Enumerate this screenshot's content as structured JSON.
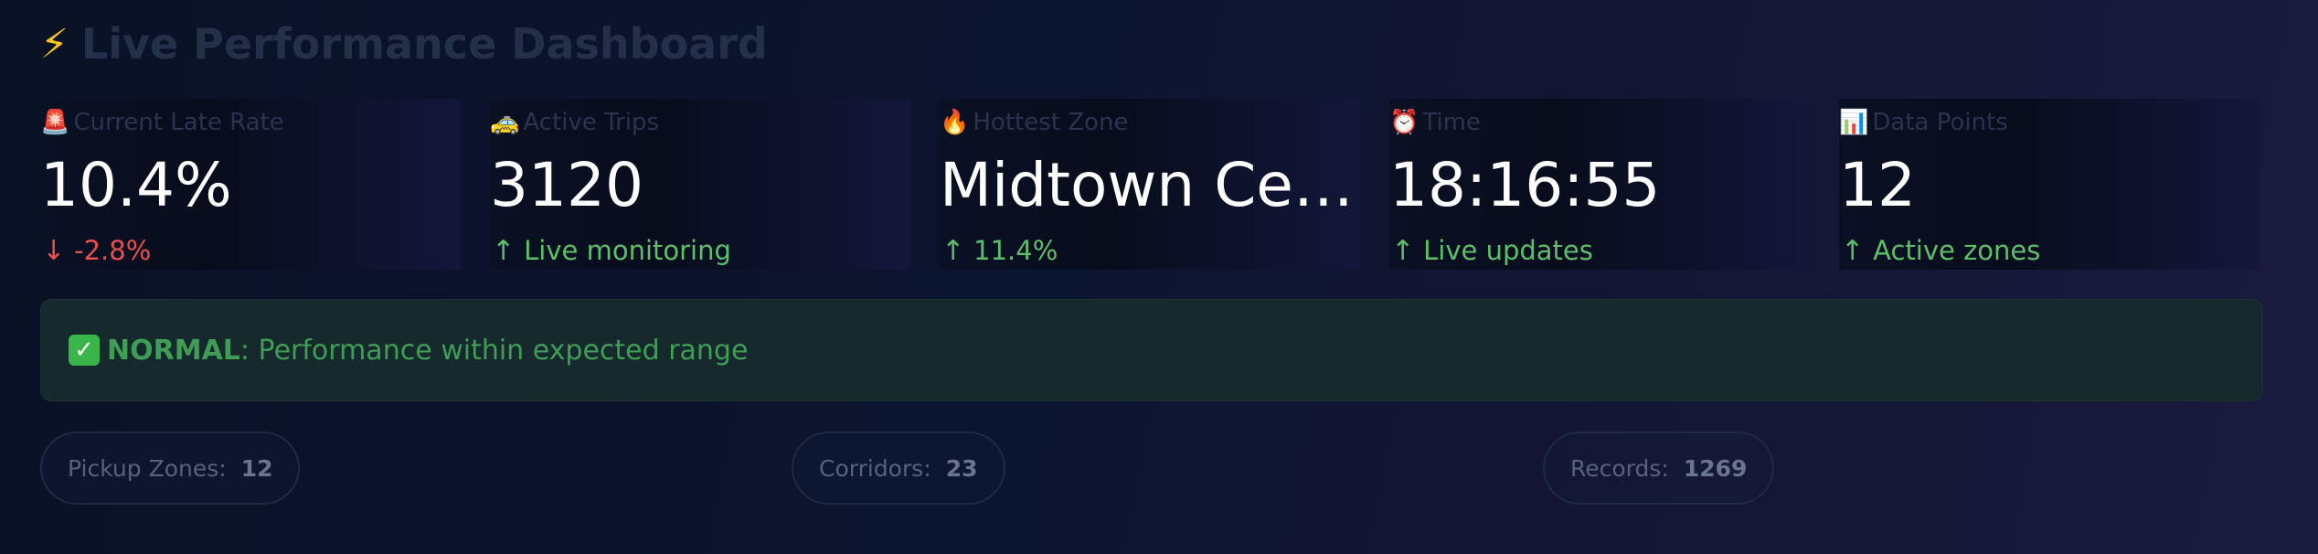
{
  "header": {
    "icon": "lightning-bolt-icon",
    "title": "Live Performance Dashboard"
  },
  "metrics": [
    {
      "icon": "siren-icon",
      "label": "Current Late Rate",
      "value": "10.4%",
      "delta": "-2.8%",
      "delta_direction": "down"
    },
    {
      "icon": "taxi-icon",
      "label": "Active Trips",
      "value": "3120",
      "delta": "Live monitoring",
      "delta_direction": "up"
    },
    {
      "icon": "fire-icon",
      "label": "Hottest Zone",
      "value": "Midtown Ce…",
      "delta": "11.4%",
      "delta_direction": "up"
    },
    {
      "icon": "alarm-clock-icon",
      "label": "Time",
      "value": "18:16:55",
      "delta": "Live updates",
      "delta_direction": "up"
    },
    {
      "icon": "bar-chart-icon",
      "label": "Data Points",
      "value": "12",
      "delta": "Active zones",
      "delta_direction": "up"
    }
  ],
  "alert": {
    "icon": "check-mark-icon",
    "status": "NORMAL",
    "message": ": Performance within expected range"
  },
  "stats": [
    {
      "label": "Pickup Zones:",
      "value": "12"
    },
    {
      "label": "Corridors:",
      "value": "23"
    },
    {
      "label": "Records:",
      "value": "1269"
    }
  ],
  "colors": {
    "positive": "#5cbf6a",
    "negative": "#e8514f",
    "alert_text": "#3f9d55",
    "alert_background": "#16292c"
  }
}
